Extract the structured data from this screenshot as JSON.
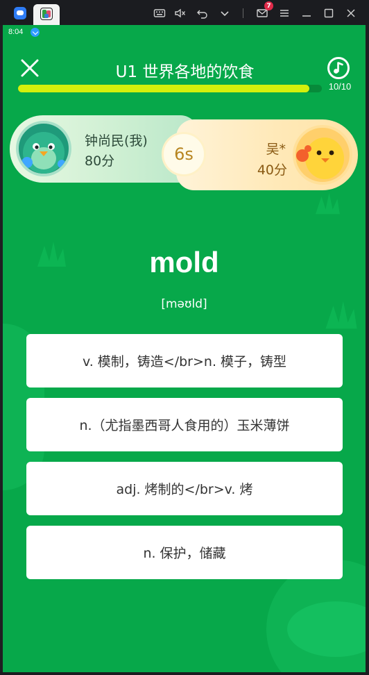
{
  "window": {
    "mail_badge": "7"
  },
  "status_bar": {
    "time": "8:04"
  },
  "header": {
    "title": "U1 世界各地的饮食",
    "progress_fraction": 0.96,
    "progress_text": "10/10"
  },
  "battle": {
    "me": {
      "name": "钟尚民(我)",
      "score": "80分"
    },
    "opponent": {
      "name": "吴*",
      "score": "40分"
    },
    "timer": "6s"
  },
  "question": {
    "word": "mold",
    "phonetic": "[məʊld]"
  },
  "options": [
    {
      "label": "v. 模制，铸造</br>n. 模子，铸型"
    },
    {
      "label": "n.（尤指墨西哥人食用的）玉米薄饼"
    },
    {
      "label": "adj. 烤制的</br>v. 烤"
    },
    {
      "label": "n. 保护，储藏"
    }
  ],
  "colors": {
    "screen_bg": "#07a84a",
    "progress_fill": "#d4f00c",
    "option_bg": "#ffffff"
  }
}
